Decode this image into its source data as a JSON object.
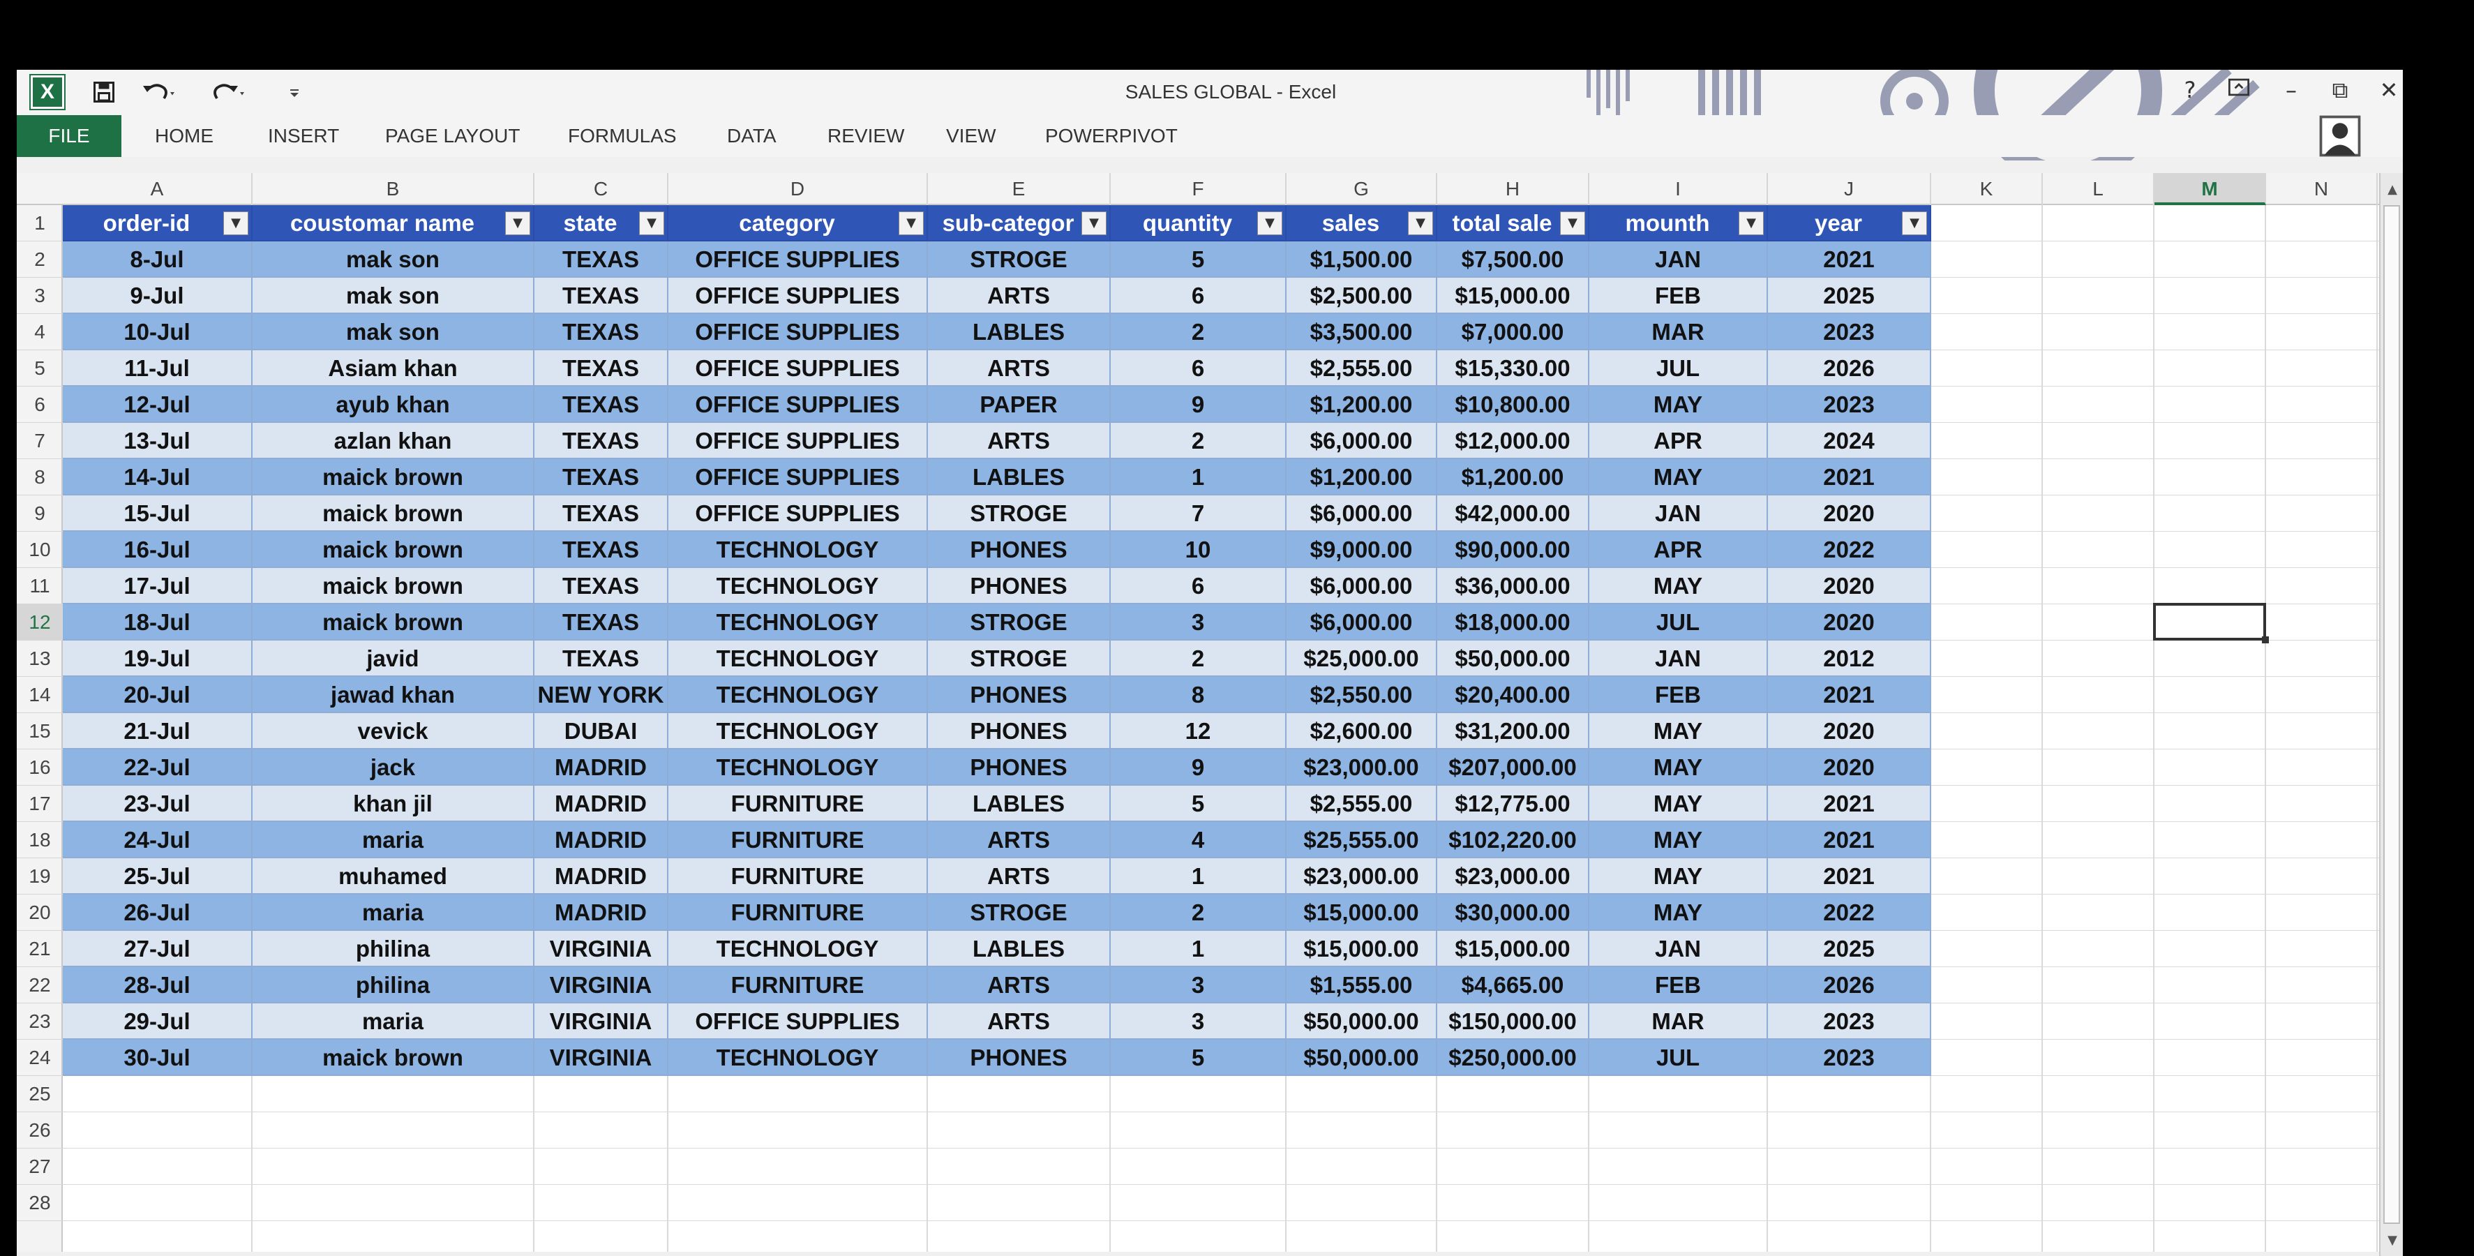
{
  "window": {
    "title": "SALES GLOBAL - Excel",
    "logo": "X",
    "help": "?",
    "minimize": "–",
    "restore": "⧉",
    "close": "✕"
  },
  "qat": {
    "save_icon": "save-icon",
    "undo_icon": "undo-icon",
    "redo_icon": "redo-icon",
    "customize_icon": "customize-icon"
  },
  "ribbon": {
    "file": "FILE",
    "tabs": [
      "HOME",
      "INSERT",
      "PAGE LAYOUT",
      "FORMULAS",
      "DATA",
      "REVIEW",
      "VIEW",
      "POWERPIVOT"
    ]
  },
  "columns": [
    "A",
    "B",
    "C",
    "D",
    "E",
    "F",
    "G",
    "H",
    "I",
    "J",
    "K",
    "L",
    "M",
    "N"
  ],
  "selected_column": "M",
  "selected_row": "12",
  "rows": [
    "1",
    "2",
    "3",
    "4",
    "5",
    "6",
    "7",
    "8",
    "9",
    "10",
    "11",
    "12",
    "13",
    "14",
    "15",
    "16",
    "17",
    "18",
    "19",
    "20",
    "21",
    "22",
    "23",
    "24",
    "25",
    "26",
    "27",
    "28"
  ],
  "table": {
    "headers": [
      "order-id",
      "coustomar name",
      "state",
      "category",
      "sub-categor",
      "quantity",
      "sales",
      "total sale",
      "mounth",
      "year"
    ],
    "data": [
      [
        "8-Jul",
        "mak son",
        "TEXAS",
        "OFFICE SUPPLIES",
        "STROGE",
        "5",
        "$1,500.00",
        "$7,500.00",
        "JAN",
        "2021"
      ],
      [
        "9-Jul",
        "mak son",
        "TEXAS",
        "OFFICE SUPPLIES",
        "ARTS",
        "6",
        "$2,500.00",
        "$15,000.00",
        "FEB",
        "2025"
      ],
      [
        "10-Jul",
        "mak son",
        "TEXAS",
        "OFFICE SUPPLIES",
        "LABLES",
        "2",
        "$3,500.00",
        "$7,000.00",
        "MAR",
        "2023"
      ],
      [
        "11-Jul",
        "Asiam khan",
        "TEXAS",
        "OFFICE SUPPLIES",
        "ARTS",
        "6",
        "$2,555.00",
        "$15,330.00",
        "JUL",
        "2026"
      ],
      [
        "12-Jul",
        "ayub khan",
        "TEXAS",
        "OFFICE SUPPLIES",
        "PAPER",
        "9",
        "$1,200.00",
        "$10,800.00",
        "MAY",
        "2023"
      ],
      [
        "13-Jul",
        "azlan khan",
        "TEXAS",
        "OFFICE SUPPLIES",
        "ARTS",
        "2",
        "$6,000.00",
        "$12,000.00",
        "APR",
        "2024"
      ],
      [
        "14-Jul",
        "maick brown",
        "TEXAS",
        "OFFICE SUPPLIES",
        "LABLES",
        "1",
        "$1,200.00",
        "$1,200.00",
        "MAY",
        "2021"
      ],
      [
        "15-Jul",
        "maick brown",
        "TEXAS",
        "OFFICE SUPPLIES",
        "STROGE",
        "7",
        "$6,000.00",
        "$42,000.00",
        "JAN",
        "2020"
      ],
      [
        "16-Jul",
        "maick brown",
        "TEXAS",
        "TECHNOLOGY",
        "PHONES",
        "10",
        "$9,000.00",
        "$90,000.00",
        "APR",
        "2022"
      ],
      [
        "17-Jul",
        "maick brown",
        "TEXAS",
        "TECHNOLOGY",
        "PHONES",
        "6",
        "$6,000.00",
        "$36,000.00",
        "MAY",
        "2020"
      ],
      [
        "18-Jul",
        "maick brown",
        "TEXAS",
        "TECHNOLOGY",
        "STROGE",
        "3",
        "$6,000.00",
        "$18,000.00",
        "JUL",
        "2020"
      ],
      [
        "19-Jul",
        "javid",
        "TEXAS",
        "TECHNOLOGY",
        "STROGE",
        "2",
        "$25,000.00",
        "$50,000.00",
        "JAN",
        "2012"
      ],
      [
        "20-Jul",
        "jawad khan",
        "NEW YORK",
        "TECHNOLOGY",
        "PHONES",
        "8",
        "$2,550.00",
        "$20,400.00",
        "FEB",
        "2021"
      ],
      [
        "21-Jul",
        "vevick",
        "DUBAI",
        "TECHNOLOGY",
        "PHONES",
        "12",
        "$2,600.00",
        "$31,200.00",
        "MAY",
        "2020"
      ],
      [
        "22-Jul",
        "jack",
        "MADRID",
        "TECHNOLOGY",
        "PHONES",
        "9",
        "$23,000.00",
        "$207,000.00",
        "MAY",
        "2020"
      ],
      [
        "23-Jul",
        "khan jil",
        "MADRID",
        "FURNITURE",
        "LABLES",
        "5",
        "$2,555.00",
        "$12,775.00",
        "MAY",
        "2021"
      ],
      [
        "24-Jul",
        "maria",
        "MADRID",
        "FURNITURE",
        "ARTS",
        "4",
        "$25,555.00",
        "$102,220.00",
        "MAY",
        "2021"
      ],
      [
        "25-Jul",
        "muhamed",
        "MADRID",
        "FURNITURE",
        "ARTS",
        "1",
        "$23,000.00",
        "$23,000.00",
        "MAY",
        "2021"
      ],
      [
        "26-Jul",
        "maria",
        "MADRID",
        "FURNITURE",
        "STROGE",
        "2",
        "$15,000.00",
        "$30,000.00",
        "MAY",
        "2022"
      ],
      [
        "27-Jul",
        "philina",
        "VIRGINIA",
        "TECHNOLOGY",
        "LABLES",
        "1",
        "$15,000.00",
        "$15,000.00",
        "JAN",
        "2025"
      ],
      [
        "28-Jul",
        "philina",
        "VIRGINIA",
        "FURNITURE",
        "ARTS",
        "3",
        "$1,555.00",
        "$4,665.00",
        "FEB",
        "2026"
      ],
      [
        "29-Jul",
        "maria",
        "VIRGINIA",
        "OFFICE SUPPLIES",
        "ARTS",
        "3",
        "$50,000.00",
        "$150,000.00",
        "MAR",
        "2023"
      ],
      [
        "30-Jul",
        "maick brown",
        "VIRGINIA",
        "TECHNOLOGY",
        "PHONES",
        "5",
        "$50,000.00",
        "$250,000.00",
        "JUL",
        "2023"
      ]
    ]
  },
  "colors": {
    "excel_green": "#1e7145",
    "table_header": "#2f55b7",
    "band_row": "#8eb4e3",
    "plain_row": "#dbe5f1"
  },
  "icons": {
    "filter": "filter-dropdown-icon",
    "user": "user-account-icon"
  }
}
